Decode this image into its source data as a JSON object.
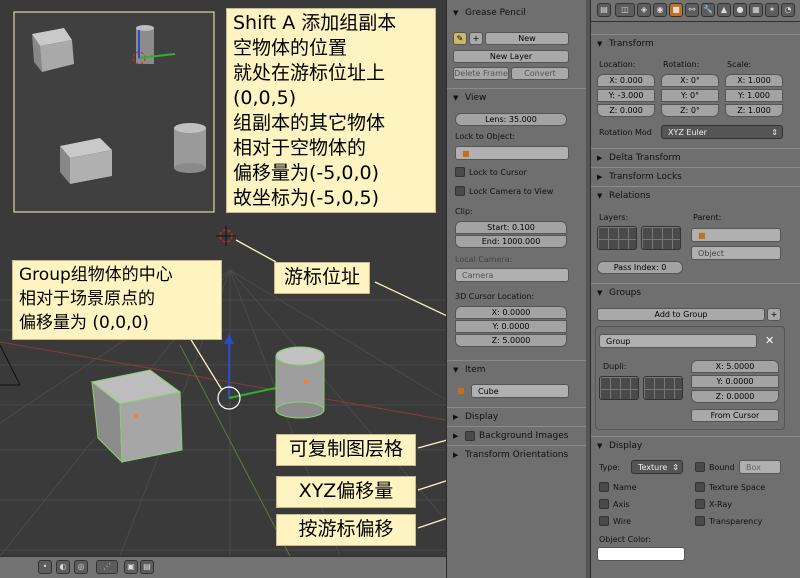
{
  "annotations": {
    "top_note": [
      "Shift A 添加组副本",
      "空物体的位置",
      "就处在游标位址上",
      "(0,0,5)",
      "组副本的其它物体",
      "相对于空物体的",
      "偏移量为(-5,0,0)",
      "故坐标为(-5,0,5)"
    ],
    "group_note": [
      "Group组物体的中心",
      "相对于场景原点的",
      "偏移量为 (0,0,0)"
    ],
    "cursor_label": "游标位址",
    "dupli_label": "可复制图层格",
    "xyz_label": "XYZ偏移量",
    "from_cursor_label": "按游标偏移"
  },
  "grease_pencil": {
    "title": "Grease Pencil",
    "new_label": "New",
    "new_layer_label": "New Layer",
    "delete_frame_label": "Delete Frame",
    "convert_label": "Convert"
  },
  "view": {
    "title": "View",
    "lens": "Lens: 35.000",
    "lock_to_object": "Lock to Object:",
    "lock_to_cursor": "Lock to Cursor",
    "lock_camera_to_view": "Lock Camera to View",
    "clip": "Clip:",
    "clip_start": "Start: 0.100",
    "clip_end": "End: 1000.000",
    "local_camera": "Local Camera:",
    "camera": "Camera",
    "cursor_location": "3D Cursor Location:",
    "cursor_x": "X: 0.0000",
    "cursor_y": "Y: 0.0000",
    "cursor_z": "Z: 5.0000"
  },
  "item": {
    "title": "Item",
    "name": "Cube"
  },
  "collapsed_panels": {
    "display": "Display",
    "background_images": "Background Images",
    "transform_orientations": "Transform Orientations"
  },
  "transform": {
    "title": "Transform",
    "location": "Location:",
    "rotation": "Rotation:",
    "scale": "Scale:",
    "loc_x": "X: 0.000",
    "loc_y": "Y: -3.000",
    "loc_z": "Z: 0.000",
    "rot_x": "X: 0°",
    "rot_y": "Y: 0°",
    "rot_z": "Z: 0°",
    "scale_x": "X: 1.000",
    "scale_y": "Y: 1.000",
    "scale_z": "Z: 1.000",
    "rotation_mode_label": "Rotation Mod",
    "rotation_mode": "XYZ Euler"
  },
  "delta_transform": "Delta Transform",
  "transform_locks": "Transform Locks",
  "relations": {
    "title": "Relations",
    "layers": "Layers:",
    "parent": "Parent:",
    "object": "Object",
    "pass_index": "Pass Index: 0"
  },
  "groups": {
    "title": "Groups",
    "add_to_group": "Add to Group",
    "group_name": "Group",
    "dupli": "Dupli:",
    "offset_x": "X: 5.0000",
    "offset_y": "Y: 0.0000",
    "offset_z": "Z: 0.0000",
    "from_cursor": "From Cursor"
  },
  "display": {
    "title": "Display",
    "type_label": "Type:",
    "type_value": "Texture",
    "bound": "Bound",
    "bound_type": "Box",
    "name": "Name",
    "texture_space": "Texture Space",
    "axis": "Axis",
    "xray": "X-Ray",
    "wire": "Wire",
    "transparency": "Transparency",
    "object_color": "Object Color:"
  }
}
